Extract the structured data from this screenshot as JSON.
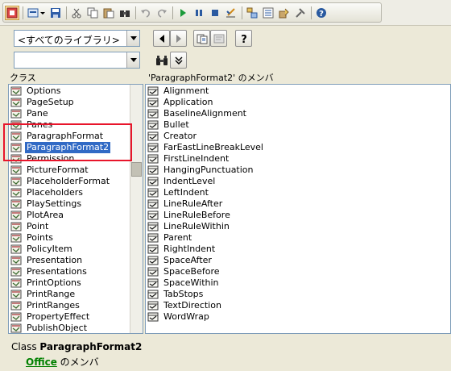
{
  "toolbar": {
    "icons": [
      "view-toggle-icon",
      "insert-icon",
      "dropdown-arrow-icon",
      "save-icon",
      "cut-icon",
      "copy-icon",
      "paste-icon",
      "find-icon",
      "undo-icon",
      "redo-icon",
      "run-icon",
      "pause-icon",
      "reset-icon",
      "design-mode-icon",
      "project-explorer-icon",
      "properties-icon",
      "object-browser-icon",
      "toolbox-icon",
      "help-icon"
    ]
  },
  "library_combo": {
    "value": "<すべてのライブラリ>"
  },
  "search_combo": {
    "value": ""
  },
  "left_pane": {
    "title": "クラス",
    "items": [
      "Options",
      "PageSetup",
      "Pane",
      "Panes",
      "ParagraphFormat",
      "ParagraphFormat2",
      "Permission",
      "PictureFormat",
      "PlaceholderFormat",
      "Placeholders",
      "PlaySettings",
      "PlotArea",
      "Point",
      "Points",
      "PolicyItem",
      "Presentation",
      "Presentations",
      "PrintOptions",
      "PrintRange",
      "PrintRanges",
      "PropertyEffect",
      "PublishObject"
    ],
    "selected_index": 5
  },
  "right_pane": {
    "title": "'ParagraphFormat2' のメンバ",
    "items": [
      "Alignment",
      "Application",
      "BaselineAlignment",
      "Bullet",
      "Creator",
      "FarEastLineBreakLevel",
      "FirstLineIndent",
      "HangingPunctuation",
      "IndentLevel",
      "LeftIndent",
      "LineRuleAfter",
      "LineRuleBefore",
      "LineRuleWithin",
      "Parent",
      "RightIndent",
      "SpaceAfter",
      "SpaceBefore",
      "SpaceWithin",
      "TabStops",
      "TextDirection",
      "WordWrap"
    ]
  },
  "details": {
    "class_prefix": "Class",
    "class_name": "ParagraphFormat2",
    "member_of_link": "Office",
    "member_of_suffix": "のメンバ"
  },
  "colors": {
    "selection": "#316ac5",
    "highlight_box": "#e8152b",
    "link": "#008000"
  }
}
